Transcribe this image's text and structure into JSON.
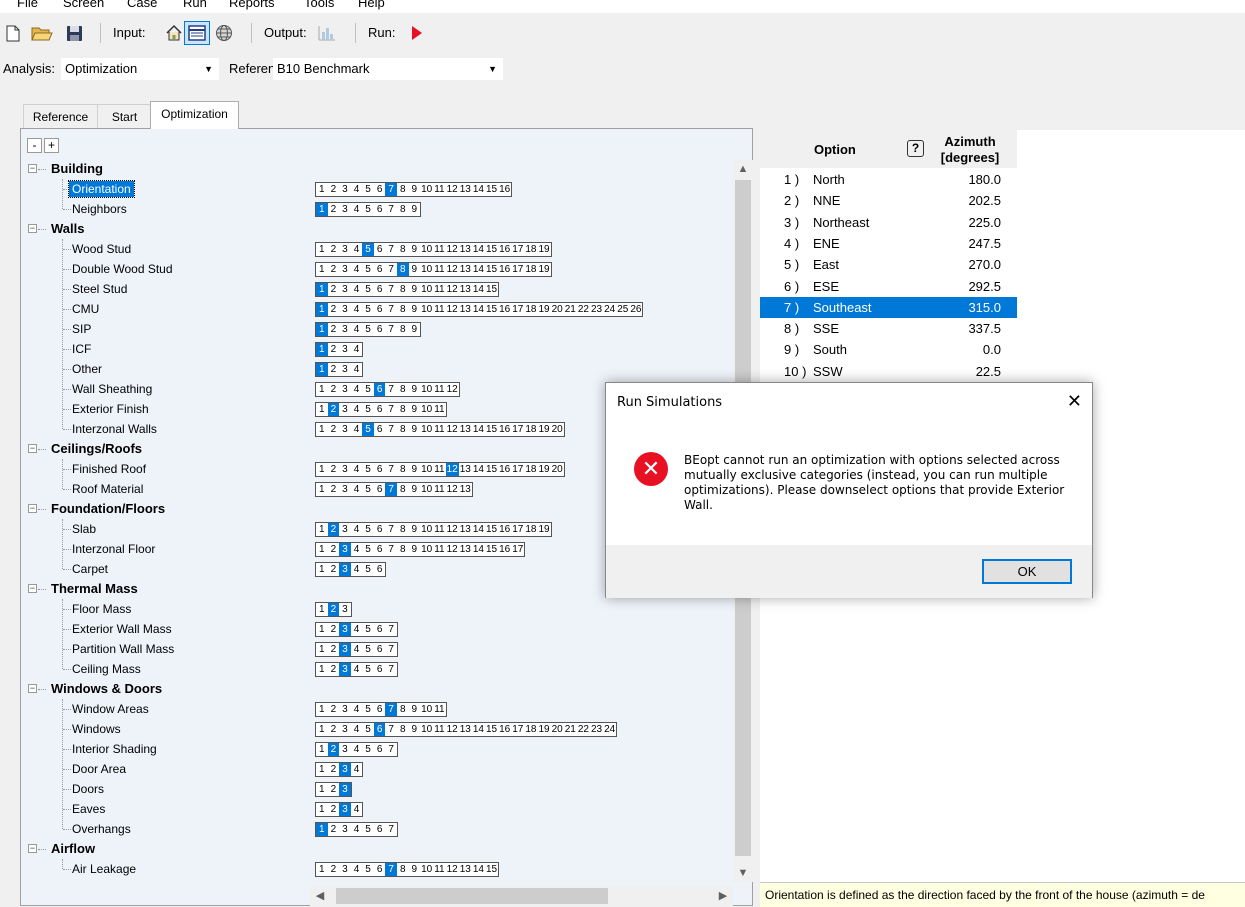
{
  "menu": [
    "File",
    "Screen",
    "Case",
    "Run",
    "Reports",
    "Tools",
    "Help"
  ],
  "toolbar": {
    "input_label": "Input:",
    "output_label": "Output:",
    "run_label": "Run:"
  },
  "analysis": {
    "label": "Analysis:",
    "value": "Optimization",
    "reference_label": "Reference:",
    "reference_value": "B10 Benchmark"
  },
  "tabs": [
    "Reference",
    "Start",
    "Optimization"
  ],
  "tree": {
    "expand_all": "+",
    "collapse_all": "-",
    "categories": [
      {
        "label": "Building",
        "items": [
          {
            "label": "Orientation",
            "count": 16,
            "selected": [
              7
            ],
            "current": true
          },
          {
            "label": "Neighbors",
            "count": 9,
            "selected": [
              1
            ]
          }
        ]
      },
      {
        "label": "Walls",
        "items": [
          {
            "label": "Wood Stud",
            "count": 19,
            "selected": [
              5
            ]
          },
          {
            "label": "Double Wood Stud",
            "count": 19,
            "selected": [
              8
            ]
          },
          {
            "label": "Steel Stud",
            "count": 15,
            "selected": [
              1
            ]
          },
          {
            "label": "CMU",
            "count": 26,
            "selected": [
              1
            ]
          },
          {
            "label": "SIP",
            "count": 9,
            "selected": [
              1
            ]
          },
          {
            "label": "ICF",
            "count": 4,
            "selected": [
              1
            ]
          },
          {
            "label": "Other",
            "count": 4,
            "selected": [
              1
            ]
          },
          {
            "label": "Wall Sheathing",
            "count": 12,
            "selected": [
              6
            ]
          },
          {
            "label": "Exterior Finish",
            "count": 11,
            "selected": [
              2
            ]
          },
          {
            "label": "Interzonal Walls",
            "count": 20,
            "selected": [
              5
            ]
          }
        ]
      },
      {
        "label": "Ceilings/Roofs",
        "items": [
          {
            "label": "Finished Roof",
            "count": 20,
            "selected": [
              12
            ]
          },
          {
            "label": "Roof Material",
            "count": 13,
            "selected": [
              7
            ]
          }
        ]
      },
      {
        "label": "Foundation/Floors",
        "items": [
          {
            "label": "Slab",
            "count": 19,
            "selected": [
              2
            ]
          },
          {
            "label": "Interzonal Floor",
            "count": 17,
            "selected": [
              3
            ]
          },
          {
            "label": "Carpet",
            "count": 6,
            "selected": [
              3
            ]
          }
        ]
      },
      {
        "label": "Thermal Mass",
        "items": [
          {
            "label": "Floor Mass",
            "count": 3,
            "selected": [
              2
            ]
          },
          {
            "label": "Exterior Wall Mass",
            "count": 7,
            "selected": [
              3
            ]
          },
          {
            "label": "Partition Wall Mass",
            "count": 7,
            "selected": [
              3
            ]
          },
          {
            "label": "Ceiling Mass",
            "count": 7,
            "selected": [
              3
            ]
          }
        ]
      },
      {
        "label": "Windows & Doors",
        "items": [
          {
            "label": "Window Areas",
            "count": 11,
            "selected": [
              7
            ]
          },
          {
            "label": "Windows",
            "count": 24,
            "selected": [
              6
            ]
          },
          {
            "label": "Interior Shading",
            "count": 7,
            "selected": [
              2
            ]
          },
          {
            "label": "Door Area",
            "count": 4,
            "selected": [
              3
            ]
          },
          {
            "label": "Doors",
            "count": 3,
            "selected": [
              3
            ]
          },
          {
            "label": "Eaves",
            "count": 4,
            "selected": [
              3
            ]
          },
          {
            "label": "Overhangs",
            "count": 7,
            "selected": [
              1
            ]
          }
        ]
      },
      {
        "label": "Airflow",
        "items": [
          {
            "label": "Air Leakage",
            "count": 15,
            "selected": [
              7
            ]
          }
        ]
      }
    ]
  },
  "options_table": {
    "col_option": "Option",
    "col_azimuth_1": "Azimuth",
    "col_azimuth_2": "[degrees]",
    "rows": [
      {
        "num": "1 )",
        "name": "North",
        "value": "180.0"
      },
      {
        "num": "2 )",
        "name": "NNE",
        "value": "202.5"
      },
      {
        "num": "3 )",
        "name": "Northeast",
        "value": "225.0"
      },
      {
        "num": "4 )",
        "name": "ENE",
        "value": "247.5"
      },
      {
        "num": "5 )",
        "name": "East",
        "value": "270.0"
      },
      {
        "num": "6 )",
        "name": "ESE",
        "value": "292.5"
      },
      {
        "num": "7 )",
        "name": "Southeast",
        "value": "315.0",
        "selected": true
      },
      {
        "num": "8 )",
        "name": "SSE",
        "value": "337.5"
      },
      {
        "num": "9 )",
        "name": "South",
        "value": "0.0"
      },
      {
        "num": "10 )",
        "name": "SSW",
        "value": "22.5"
      }
    ]
  },
  "status": "Orientation is defined as the direction faced by the front of the house (azimuth = de",
  "dialog": {
    "title": "Run Simulations",
    "message": "BEopt cannot run an optimization with options selected across mutually exclusive categories (instead, you can run multiple optimizations). Please downselect options that provide Exterior Wall.",
    "ok": "OK"
  },
  "colors": {
    "selection": "#0078d7",
    "tree_bg": "#eef3fa",
    "error": "#e81123",
    "run": "#e81123",
    "status_bg": "#ffffe1"
  },
  "icons": [
    "new-file-icon",
    "open-folder-icon",
    "save-icon",
    "home-icon",
    "table-icon",
    "globe-icon",
    "bar-chart-icon",
    "play-icon",
    "error-icon",
    "close-icon",
    "help-icon"
  ]
}
